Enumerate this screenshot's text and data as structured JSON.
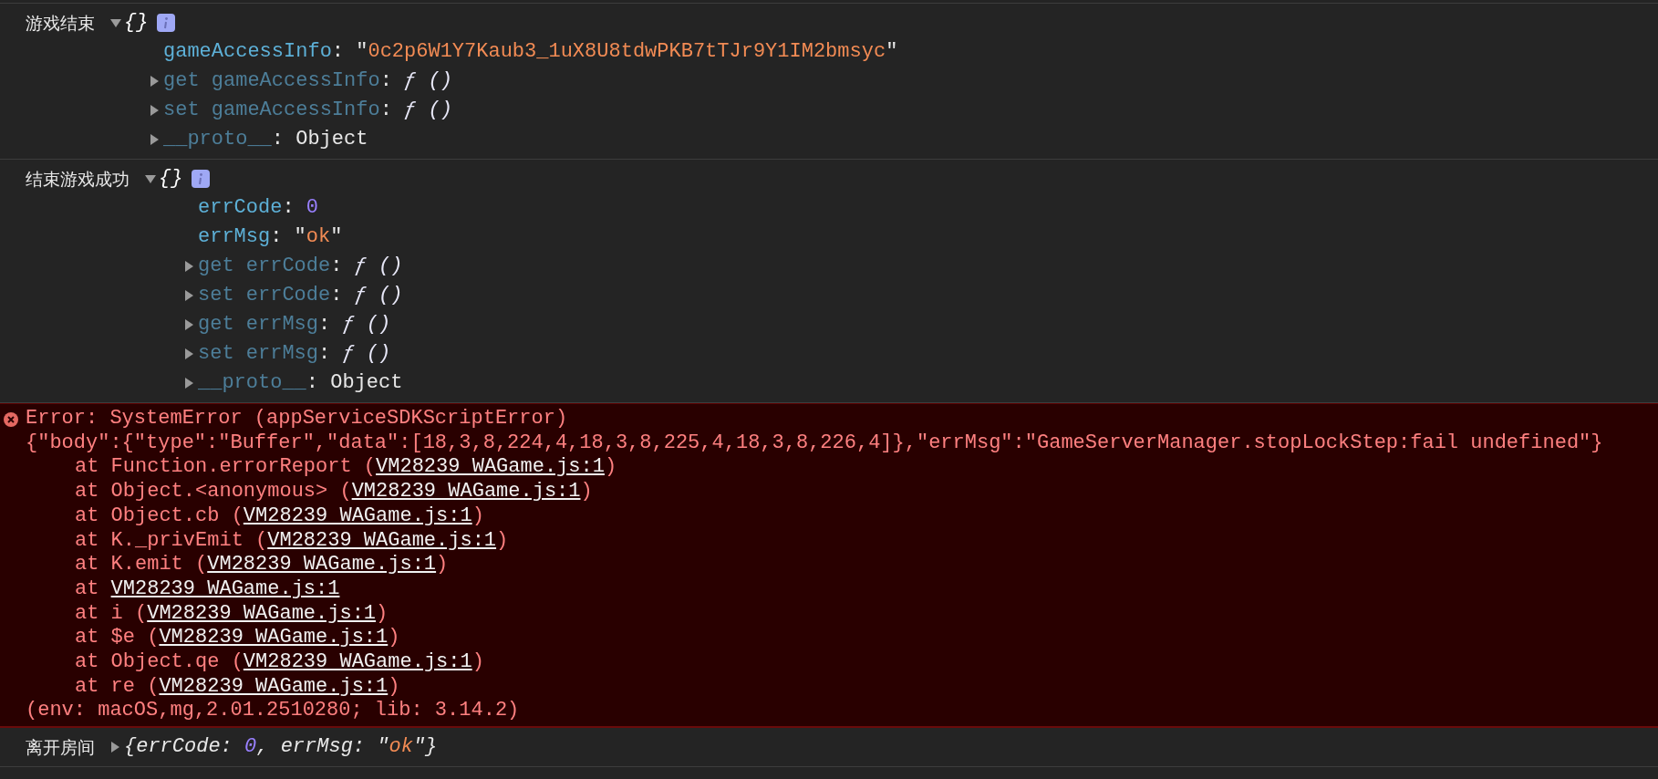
{
  "console": [
    {
      "kind": "object",
      "label": "游戏结束",
      "expanded": true,
      "summary": "{}",
      "properties": [
        {
          "kind": "field",
          "key": "gameAccessInfo",
          "sep": ":",
          "value": [
            {
              "t": "\"",
              "kind": "punct"
            },
            {
              "t": "0c2p6W1Y7Kaub3_1uX8U8tdwPKB7tTJr9Y1IM2bmsyc",
              "kind": "string"
            },
            {
              "t": "\"",
              "kind": "punct"
            }
          ]
        },
        {
          "kind": "accessor",
          "expanded": false,
          "key": "get gameAccessInfo",
          "sep": ":",
          "value": [
            {
              "t": "ƒ ()",
              "kind": "func"
            }
          ]
        },
        {
          "kind": "accessor",
          "expanded": false,
          "key": "set gameAccessInfo",
          "sep": ":",
          "value": [
            {
              "t": "ƒ ()",
              "kind": "func"
            }
          ]
        },
        {
          "kind": "accessor",
          "expanded": false,
          "key": "__proto__",
          "sep": ":",
          "value": [
            {
              "t": "Object",
              "kind": "plain"
            }
          ]
        }
      ]
    },
    {
      "kind": "object",
      "label": "结束游戏成功",
      "expanded": true,
      "summary": "{}",
      "properties": [
        {
          "kind": "field",
          "key": "errCode",
          "sep": ":",
          "value": [
            {
              "t": "0",
              "kind": "number"
            }
          ]
        },
        {
          "kind": "field",
          "key": "errMsg",
          "sep": ":",
          "value": [
            {
              "t": "\"",
              "kind": "punct"
            },
            {
              "t": "ok",
              "kind": "string"
            },
            {
              "t": "\"",
              "kind": "punct"
            }
          ]
        },
        {
          "kind": "accessor",
          "expanded": false,
          "key": "get errCode",
          "sep": ":",
          "value": [
            {
              "t": "ƒ ()",
              "kind": "func"
            }
          ]
        },
        {
          "kind": "accessor",
          "expanded": false,
          "key": "set errCode",
          "sep": ":",
          "value": [
            {
              "t": "ƒ ()",
              "kind": "func"
            }
          ]
        },
        {
          "kind": "accessor",
          "expanded": false,
          "key": "get errMsg",
          "sep": ":",
          "value": [
            {
              "t": "ƒ ()",
              "kind": "func"
            }
          ]
        },
        {
          "kind": "accessor",
          "expanded": false,
          "key": "set errMsg",
          "sep": ":",
          "value": [
            {
              "t": "ƒ ()",
              "kind": "func"
            }
          ]
        },
        {
          "kind": "accessor",
          "expanded": false,
          "key": "__proto__",
          "sep": ":",
          "value": [
            {
              "t": "Object",
              "kind": "plain"
            }
          ]
        }
      ]
    },
    {
      "kind": "error",
      "lines": [
        {
          "text": "Error: SystemError (appServiceSDKScriptError)"
        },
        {
          "text": "{\"body\":{\"type\":\"Buffer\",\"data\":[18,3,8,224,4,18,3,8,225,4,18,3,8,226,4]},\"errMsg\":\"GameServerManager.stopLockStep:fail undefined\"}"
        },
        {
          "text": "at Function.errorReport (",
          "link": "VM28239 WAGame.js:1",
          "tail": ")"
        },
        {
          "text": "at Object.<anonymous> (",
          "link": "VM28239 WAGame.js:1",
          "tail": ")"
        },
        {
          "text": "at Object.cb (",
          "link": "VM28239 WAGame.js:1",
          "tail": ")"
        },
        {
          "text": "at K._privEmit (",
          "link": "VM28239 WAGame.js:1",
          "tail": ")"
        },
        {
          "text": "at K.emit (",
          "link": "VM28239 WAGame.js:1",
          "tail": ")"
        },
        {
          "text": "at ",
          "link": "VM28239 WAGame.js:1"
        },
        {
          "text": "at i (",
          "link": "VM28239 WAGame.js:1",
          "tail": ")"
        },
        {
          "text": "at $e (",
          "link": "VM28239 WAGame.js:1",
          "tail": ")"
        },
        {
          "text": "at Object.qe (",
          "link": "VM28239 WAGame.js:1",
          "tail": ")"
        },
        {
          "text": "at re (",
          "link": "VM28239 WAGame.js:1",
          "tail": ")"
        },
        {
          "text": "(env: macOS,mg,2.01.2510280; lib: 3.14.2)"
        }
      ]
    },
    {
      "kind": "inline",
      "label": "离开房间",
      "expanded": false,
      "value": [
        {
          "t": "{errCode: ",
          "kind": "ikey"
        },
        {
          "t": "0",
          "kind": "number"
        },
        {
          "t": ", errMsg: ",
          "kind": "ikey"
        },
        {
          "t": "\"",
          "kind": "punct"
        },
        {
          "t": "ok",
          "kind": "string"
        },
        {
          "t": "\"",
          "kind": "punct"
        },
        {
          "t": "}",
          "kind": "ikey"
        }
      ]
    }
  ]
}
